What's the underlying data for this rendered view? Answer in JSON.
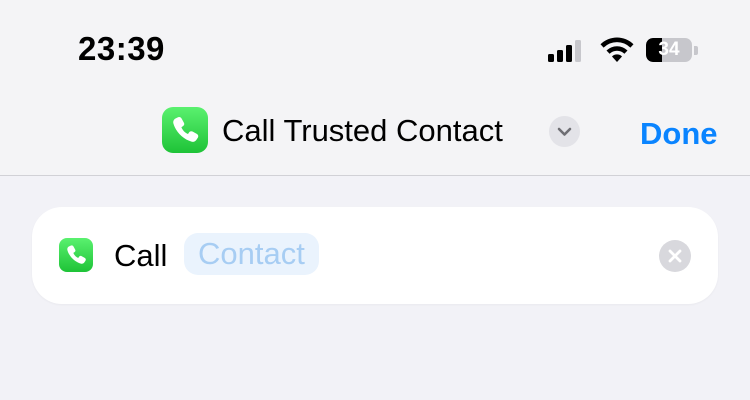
{
  "status_bar": {
    "time": "23:39",
    "battery_percent": 34,
    "battery_label": "34",
    "signal_bars": 3,
    "icons": [
      "cellular-signal-icon",
      "wifi-icon",
      "battery-icon"
    ]
  },
  "nav": {
    "app_icon": "phone-icon",
    "title": "Call Trusted Contact",
    "title_menu_icon": "chevron-down-icon",
    "done_label": "Done"
  },
  "action": {
    "app_icon": "phone-icon",
    "verb": "Call",
    "parameter_placeholder": "Contact",
    "clear_icon": "clear-icon"
  },
  "colors": {
    "accent": "#0a84ff",
    "phone_green": "#34c759",
    "token_bg": "#eaf3fd",
    "token_text": "#a7cdf3",
    "background": "#f2f2f7"
  }
}
